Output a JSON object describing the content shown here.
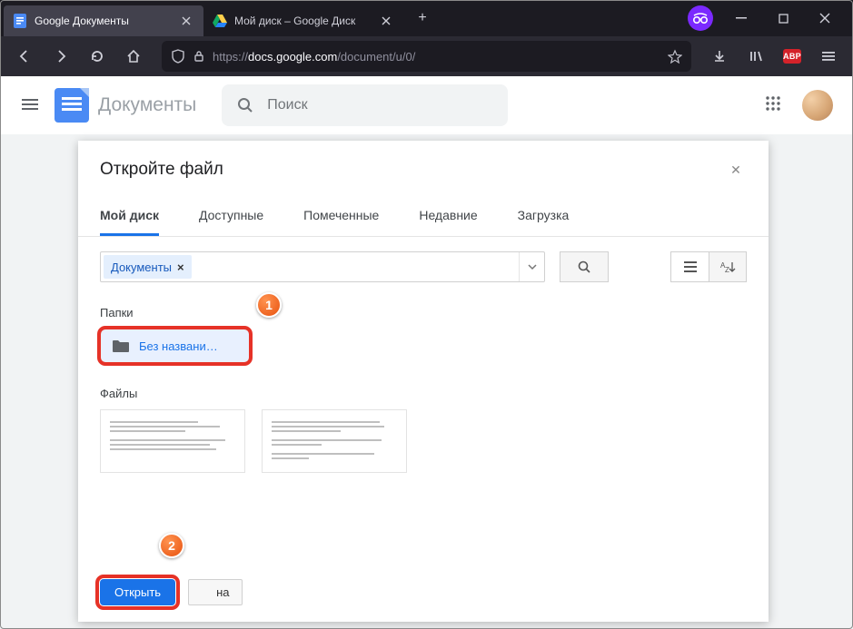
{
  "browser": {
    "tabs": [
      {
        "label": "Google Документы",
        "active": true
      },
      {
        "label": "Мой диск – Google Диск",
        "active": false
      }
    ],
    "url_scheme": "https://",
    "url_host": "docs.google.com",
    "url_path": "/document/u/0/",
    "abp": "ABP"
  },
  "docs": {
    "title": "Документы",
    "search_placeholder": "Поиск"
  },
  "modal": {
    "title": "Откройте файл",
    "tabs": {
      "mydrive": "Мой диск",
      "shared": "Доступные",
      "starred": "Помеченные",
      "recent": "Недавние",
      "upload": "Загрузка"
    },
    "filter_chip": "Документы",
    "folders_label": "Папки",
    "folder_name": "Без названи…",
    "files_label": "Файлы",
    "open_btn": "Открыть",
    "cancel_suffix": "на"
  },
  "callouts": {
    "one": "1",
    "two": "2"
  }
}
